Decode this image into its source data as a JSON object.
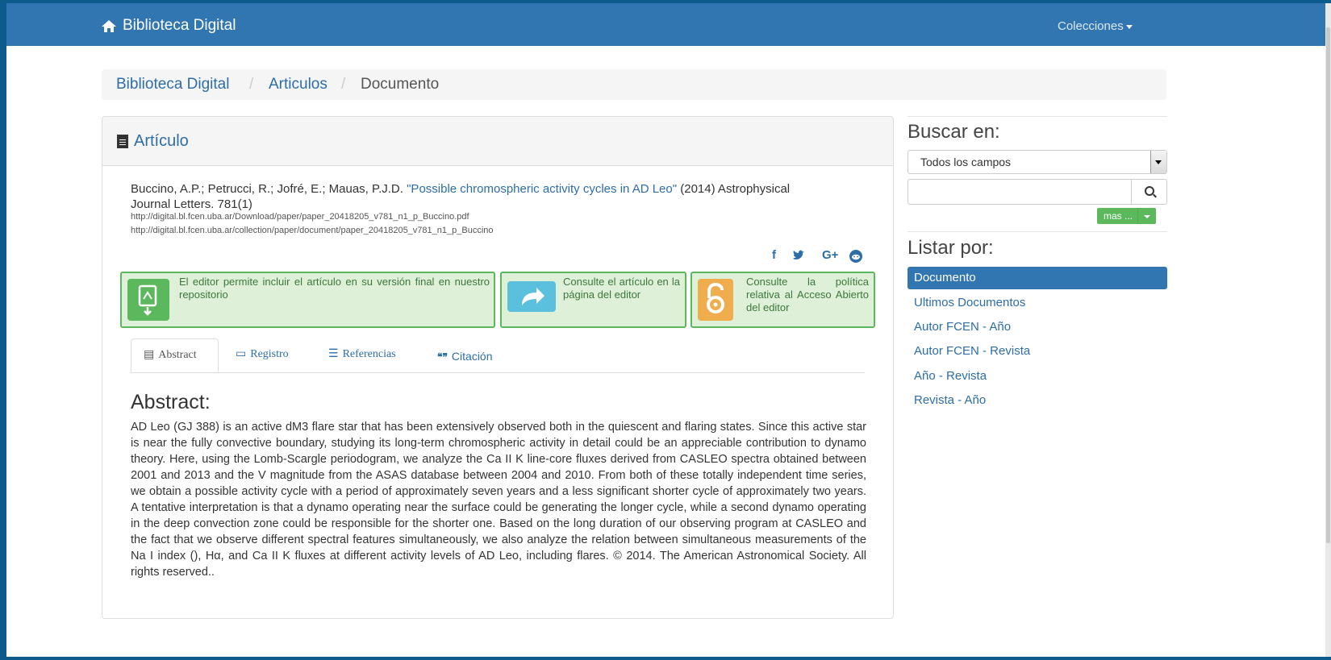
{
  "navbar": {
    "brand": "Biblioteca Digital",
    "menu": "Colecciones"
  },
  "breadcrumb": {
    "items": [
      "Biblioteca Digital",
      "Articulos"
    ],
    "current": "Documento",
    "separator": "/"
  },
  "panel": {
    "title": "Artículo",
    "citation": {
      "authors": "Buccino, A.P.; Petrucci, R.; Jofré, E.; Mauas, P.J.D.",
      "title": "\"Possible chromospheric activity cycles in AD Leo\"",
      "rest_line1": "(2014) Astrophysical",
      "rest_line2": "Journal Letters. 781(1)"
    },
    "urls": [
      "http://digital.bl.fcen.uba.ar/Download/paper/paper_20418205_v781_n1_p_Buccino.pdf",
      "http://digital.bl.fcen.uba.ar/collection/paper/document/paper_20418205_v781_n1_p_Buccino"
    ],
    "social": [
      "f",
      "🐦",
      "G+",
      "reddit"
    ],
    "info_boxes": [
      {
        "text": "El editor permite incluir el artículo en su versión final en nuestro repositorio",
        "icon": "pdf-download-icon",
        "color": "#5cb85c"
      },
      {
        "text": "Consulte el artículo en la página del editor",
        "icon": "share-arrow-icon",
        "color": "#5bc0de"
      },
      {
        "text": "Consulte la política relativa al Acceso Abierto del editor",
        "icon": "open-access-icon",
        "color": "#f0ad4e"
      }
    ],
    "tabs": [
      "Abstract",
      "Registro",
      "Referencias",
      "Citación"
    ],
    "abstract_heading": "Abstract:",
    "abstract_text": "AD Leo (GJ 388) is an active dM3 flare star that has been extensively observed both in the quiescent and flaring states. Since this active star is near the fully convective boundary, studying its long-term chromospheric activity in detail could be an appreciable contribution to dynamo theory. Here, using the Lomb-Scargle periodogram, we analyze the Ca II K line-core fluxes derived from CASLEO spectra obtained between 2001 and 2013 and the V magnitude from the ASAS database between 2004 and 2010. From both of these totally independent time series, we obtain a possible activity cycle with a period of approximately seven years and a less significant shorter cycle of approximately two years. A tentative interpretation is that a dynamo operating near the surface could be generating the longer cycle, while a second dynamo operating in the deep convection zone could be responsible for the shorter one. Based on the long duration of our observing program at CASLEO and the fact that we observe different spectral features simultaneously, we also analyze the relation between simultaneous measurements of the Na I index (), Hα, and Ca II K fluxes at different activity levels of AD Leo, including flares. © 2014. The American Astronomical Society. All rights reserved.."
  },
  "sidebar": {
    "search_heading": "Buscar en:",
    "select_value": "Todos los campos",
    "search_value": "",
    "mas_label": "mas ...",
    "list_heading": "Listar por:",
    "list_items": [
      "Documento",
      "Ultimos Documentos",
      "Autor FCEN - Año",
      "Autor FCEN - Revista",
      "Año - Revista",
      "Revista - Año"
    ]
  }
}
